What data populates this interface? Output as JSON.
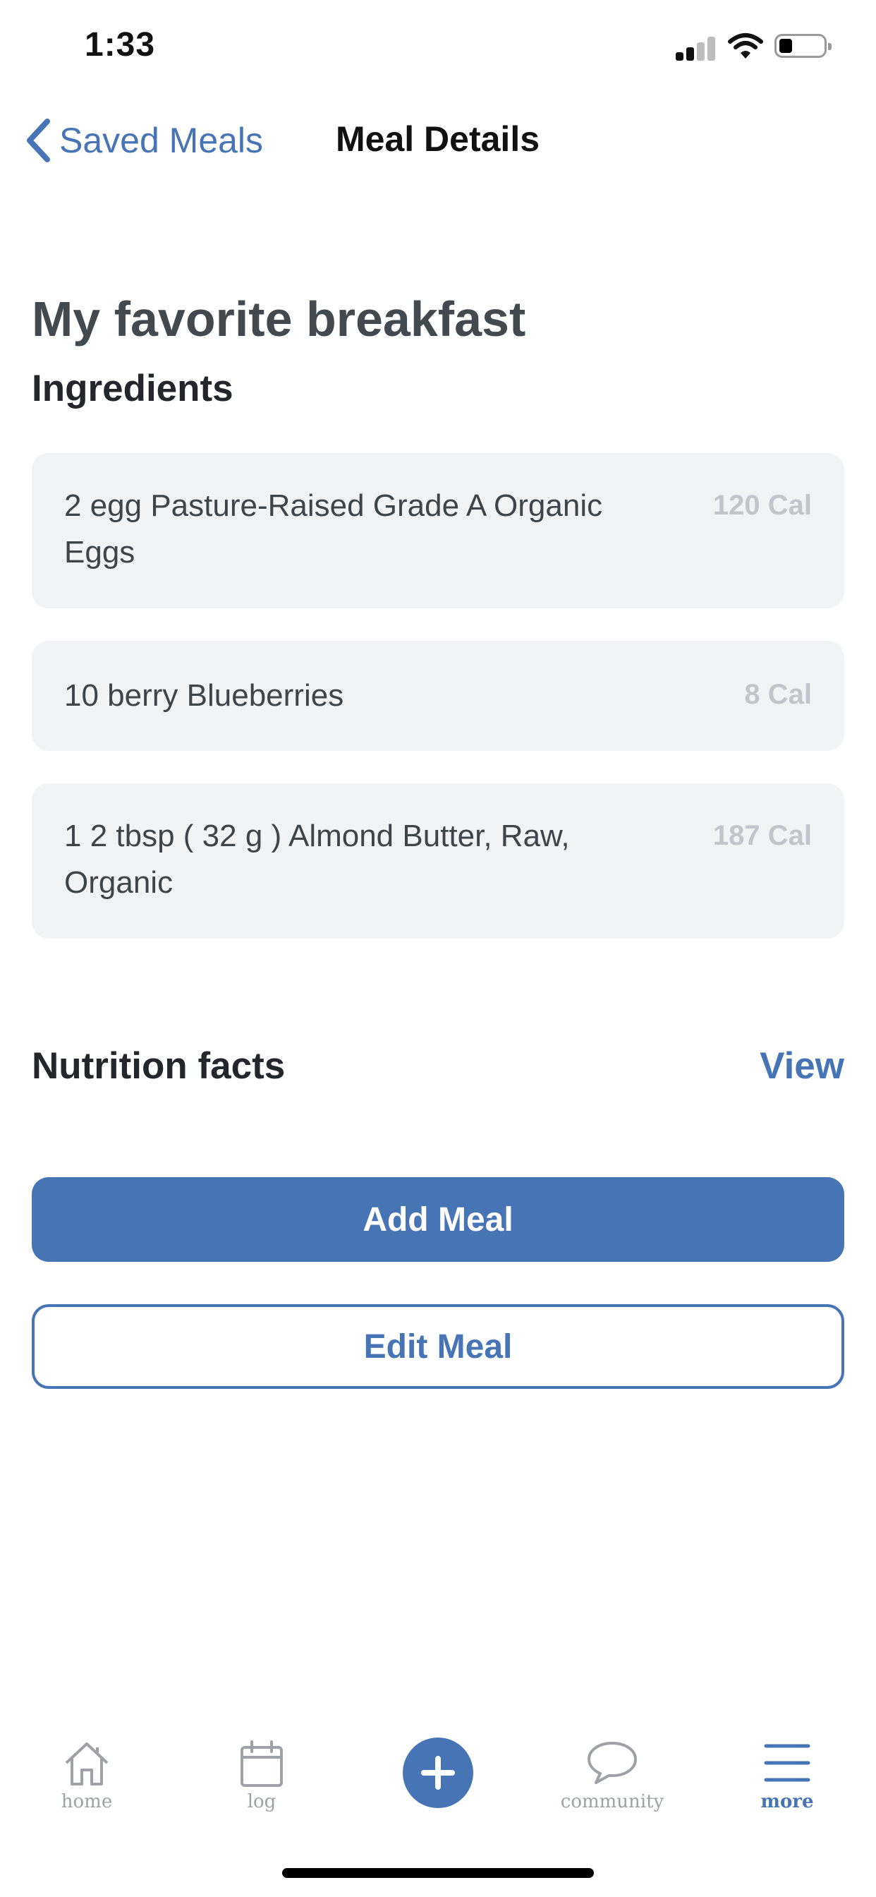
{
  "status_bar": {
    "time": "1:33"
  },
  "nav": {
    "back_label": "Saved Meals",
    "title": "Meal Details"
  },
  "meal": {
    "name": "My favorite breakfast",
    "ingredients_title": "Ingredients",
    "ingredients": [
      {
        "name": "2 egg Pasture-Raised Grade A Organic Eggs",
        "calories": "120 Cal"
      },
      {
        "name": "10 berry Blueberries",
        "calories": "8 Cal"
      },
      {
        "name": "1 2 tbsp ( 32 g ) Almond Butter, Raw, Organic",
        "calories": "187 Cal"
      }
    ]
  },
  "nutrition": {
    "title": "Nutrition facts",
    "view_label": "View"
  },
  "actions": {
    "add_label": "Add Meal",
    "edit_label": "Edit Meal"
  },
  "tab_bar": {
    "items": [
      {
        "label": "home",
        "icon": "home-icon"
      },
      {
        "label": "log",
        "icon": "calendar-icon"
      },
      {
        "label": "",
        "icon": "plus-icon"
      },
      {
        "label": "community",
        "icon": "chat-bubble-icon"
      },
      {
        "label": "more",
        "icon": "menu-icon"
      }
    ],
    "active": "more"
  },
  "colors": {
    "accent": "#4674b4",
    "card_bg": "#f2f3f5",
    "muted": "#c2c5c9"
  }
}
